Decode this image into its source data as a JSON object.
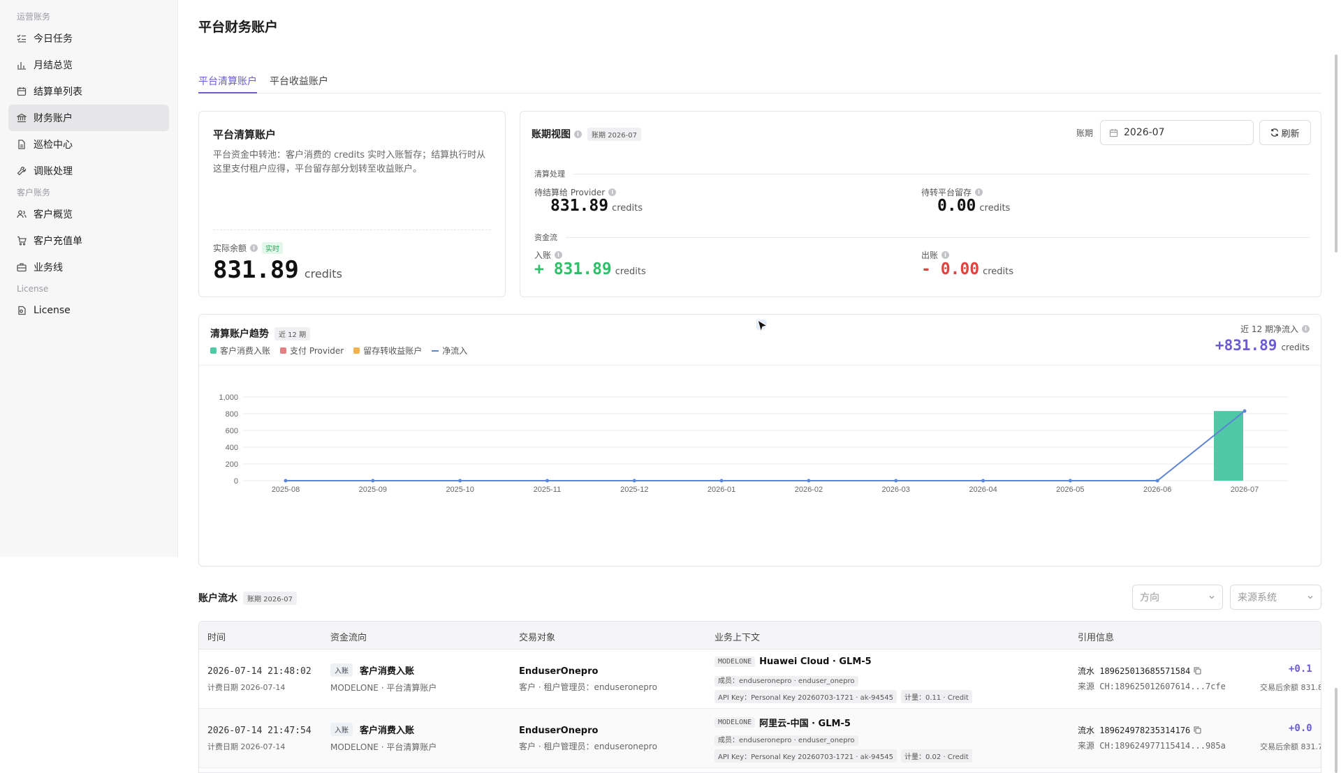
{
  "sidebar": {
    "sections": [
      {
        "label": "运营账务",
        "items": [
          {
            "label": "今日任务",
            "icon": "task-list-icon"
          },
          {
            "label": "月结总览",
            "icon": "bar-chart-icon"
          },
          {
            "label": "结算单列表",
            "icon": "calendar-icon"
          },
          {
            "label": "财务账户",
            "icon": "bank-icon",
            "active": true
          },
          {
            "label": "巡检中心",
            "icon": "document-icon"
          },
          {
            "label": "调账处理",
            "icon": "wrench-icon"
          }
        ]
      },
      {
        "label": "客户账务",
        "items": [
          {
            "label": "客户概览",
            "icon": "users-icon"
          },
          {
            "label": "客户充值单",
            "icon": "cart-icon"
          },
          {
            "label": "业务线",
            "icon": "briefcase-icon"
          }
        ]
      },
      {
        "label": "License",
        "items": [
          {
            "label": "License",
            "icon": "license-icon"
          }
        ]
      }
    ]
  },
  "page": {
    "title": "平台财务账户"
  },
  "tabs": [
    {
      "label": "平台清算账户",
      "active": true
    },
    {
      "label": "平台收益账户",
      "active": false
    }
  ],
  "clearing_card": {
    "title": "平台清算账户",
    "desc_line1": "平台资金中转池：客户消费的 credits 实时入账暂存；结算执行时从",
    "desc_line2": "这里支付租户应得，平台留存部分划转至收益账户。",
    "balance_label": "实际余额",
    "realtime_badge": "实时",
    "balance": "831.89",
    "unit": "credits"
  },
  "period_view": {
    "title": "账期视图",
    "badge": "账期 2026-07",
    "period_label": "账期",
    "period_value": "2026-07",
    "refresh_label": "刷新",
    "group_settle": "清算处理",
    "group_flow": "资金流",
    "pending_provider_label": "待结算给 Provider",
    "pending_provider_value": "831.89",
    "pending_retain_label": "待转平台留存",
    "pending_retain_value": "0.00",
    "in_label": "入账",
    "in_value": "+ 831.89",
    "out_label": "出账",
    "out_value": "- 0.00",
    "unit": "credits"
  },
  "trend": {
    "title": "清算账户趋势",
    "badge": "近 12 期",
    "net_label": "近 12 期净流入",
    "net_value": "+831.89",
    "net_unit": "credits"
  },
  "colors": {
    "accent": "#6b5cd6",
    "bar_consume": "#4fc9a5",
    "provider": "#e57f86",
    "retain": "#f0b24d",
    "net_line": "#5b86d6"
  },
  "chart_data": {
    "type": "bar",
    "categories": [
      "2025-08",
      "2025-09",
      "2025-10",
      "2025-11",
      "2025-12",
      "2026-01",
      "2026-02",
      "2026-03",
      "2026-04",
      "2026-05",
      "2026-06",
      "2026-07"
    ],
    "series": [
      {
        "name": "客户消费入账",
        "type": "bar",
        "values": [
          0,
          0,
          0,
          0,
          0,
          0,
          0,
          0,
          0,
          0,
          0,
          831.89
        ]
      },
      {
        "name": "支付 Provider",
        "type": "bar",
        "values": [
          0,
          0,
          0,
          0,
          0,
          0,
          0,
          0,
          0,
          0,
          0,
          0
        ]
      },
      {
        "name": "留存转收益账户",
        "type": "bar",
        "values": [
          0,
          0,
          0,
          0,
          0,
          0,
          0,
          0,
          0,
          0,
          0,
          0
        ]
      },
      {
        "name": "净流入",
        "type": "line",
        "values": [
          0,
          0,
          0,
          0,
          0,
          0,
          0,
          0,
          0,
          0,
          0,
          831.89
        ]
      }
    ],
    "yticks": [
      "0",
      "200",
      "400",
      "600",
      "800",
      "1,000"
    ],
    "ylim": [
      0,
      1000
    ],
    "title": "",
    "xlabel": "",
    "ylabel": "",
    "grid": true,
    "legend": "top-left"
  },
  "ledger": {
    "title": "账户流水",
    "badge": "账期 2026-07",
    "filter_direction": "方向",
    "filter_source": "来源系统",
    "columns": [
      "时间",
      "资金流向",
      "交易对象",
      "业务上下文",
      "引用信息"
    ],
    "rows": [
      {
        "time": "2026-07-14 21:48:02",
        "bill_date": "计费日期 2026-07-14",
        "dir_tag": "入账",
        "dir_label": "客户消费入账",
        "dir_sub": "MODELONE · 平台清算账户",
        "party": "EnduserOnepro",
        "party_sub": "客户 · 租户管理员：enduseronepro",
        "ctx_tag": "MODELONE",
        "ctx_title": "Huawei Cloud · GLM-5",
        "ctx_member": "成员：enduseronepro · enduser_onepro",
        "ctx_key": "API Key：Personal Key 20260703-1721 · ak-94545",
        "ctx_meter": "计量：0.11 · Credit",
        "ref_flow": "流水 189625013685571584",
        "ref_src": "来源 CH:189625012607614...7cfe",
        "amount": "+0.1",
        "after": "交易后余额 831.8"
      },
      {
        "time": "2026-07-14 21:47:54",
        "bill_date": "计费日期 2026-07-14",
        "dir_tag": "入账",
        "dir_label": "客户消费入账",
        "dir_sub": "MODELONE · 平台清算账户",
        "party": "EnduserOnepro",
        "party_sub": "客户 · 租户管理员：enduseronepro",
        "ctx_tag": "MODELONE",
        "ctx_title": "阿里云-中国 · GLM-5",
        "ctx_member": "成员：enduseronepro · enduser_onepro",
        "ctx_key": "API Key：Personal Key 20260703-1721 · ak-94545",
        "ctx_meter": "计量：0.02 · Credit",
        "ref_flow": "流水 189624978235314176",
        "ref_src": "来源 CH:189624977115414...985a",
        "amount": "+0.0",
        "after": "交易后余额 831.7"
      }
    ]
  }
}
